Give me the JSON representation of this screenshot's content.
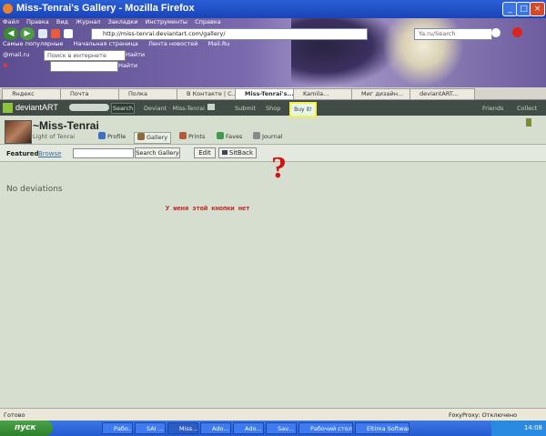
{
  "window": {
    "title": "Miss-Tenrai's Gallery - Mozilla Firefox",
    "minimize": "_",
    "maximize": "□",
    "close": "×"
  },
  "menu": [
    "Файл",
    "Правка",
    "Вид",
    "Журнал",
    "Закладки",
    "Инструменты",
    "Справка"
  ],
  "nav": {
    "back": "◀",
    "forward": "▶",
    "url": "http://miss-tenrai.deviantart.com/gallery/",
    "search_placeholder": "Ya.ru/Search"
  },
  "bookmarks": [
    "Самые популярные",
    "Начальная страница",
    "Лента новостей",
    "Mail.Ru"
  ],
  "toolbar2": {
    "mailru": "@mail.ru",
    "search_placeholder": "Поиск в интернете",
    "find": "Найти"
  },
  "tabs": [
    "Яндекс",
    "Почта",
    "Полка",
    "В Контакте | С...",
    "Miss-Tenrai's...",
    "Kamila...",
    "Миг дизайн...",
    "deviantART..."
  ],
  "deviantart": {
    "logo": "deviantART",
    "search_button": "Search",
    "user_label": "Deviant · Miss-Tenrai",
    "submit": "Submit",
    "shop": "Shop",
    "buy_it": "Buy it!",
    "friends": "Friends",
    "collect": "Collect"
  },
  "profile": {
    "username": "~Miss-Tenrai",
    "tagline": "Light of Tenrai",
    "tabs": [
      "Profile",
      "Gallery",
      "Prints",
      "Faves",
      "Journal"
    ]
  },
  "gallery_bar": {
    "featured": "Featured",
    "browse": "Browse",
    "search_button": "Search Gallery",
    "edit": "Edit",
    "sitback": "SitBack"
  },
  "annotation": {
    "question_mark": "?",
    "note": "У меня этой кнопки нет"
  },
  "content": {
    "empty_message": "No deviations"
  },
  "status": {
    "left": "Готово",
    "proxy": "FoxyProxy: Отключено"
  },
  "taskbar": {
    "start": "пуск",
    "tasks": [
      "Рабо...",
      "SAI ...",
      "Miss...",
      "Ado...",
      "Ado...",
      "Sav...",
      "Рабочий стол",
      "Eltima Software"
    ],
    "clock": "14:08"
  }
}
